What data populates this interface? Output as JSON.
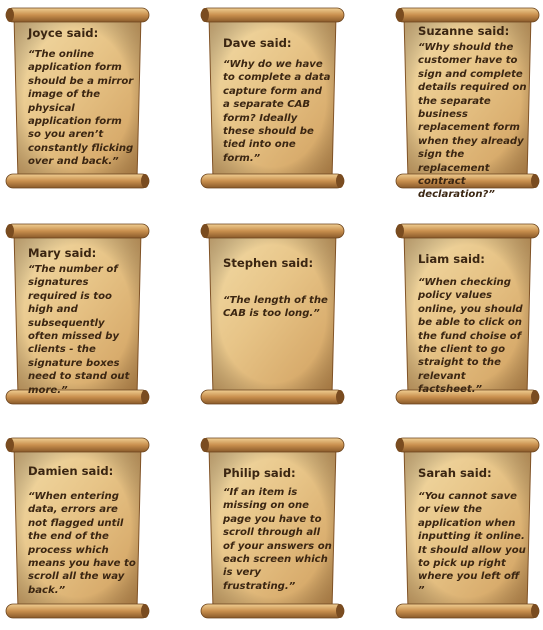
{
  "quotes": [
    {
      "name": "Joyce said:",
      "text": "“The online application form should be a mirror image of the physical application form so you aren’t constantly flicking over and back.”"
    },
    {
      "name": "Dave said:",
      "text": "“Why do we have to complete a data capture form and a separate CAB form? Ideally these should be tied into one form.”"
    },
    {
      "name": "Suzanne said:",
      "text": "“Why should the customer have to sign and complete details required on the separate business replacement form when they already sign the replacement contract declaration?”"
    },
    {
      "name": "Mary said:",
      "text": "“The number of signatures required is too high and subsequently often missed by clients - the signature boxes need to stand out more.”"
    },
    {
      "name": "Stephen said:",
      "text": "“The length of the CAB is too long.”"
    },
    {
      "name": "Liam said:",
      "text": "“When checking policy values online, you should be able to click on the fund choise of the client to go straight to the relevant factsheet.”"
    },
    {
      "name": "Damien said:",
      "text": "“When entering data, errors are not flagged until the end of the process which means you have to scroll all the way back.”"
    },
    {
      "name": "Philip said:",
      "text": "“If an item is missing on one page you have to scroll through all of your answers on each screen which is very frustrating.”"
    },
    {
      "name": "Sarah said:",
      "text": "“You cannot save or view the application when inputting it online. It should allow you to pick up right where you left off ”"
    }
  ]
}
